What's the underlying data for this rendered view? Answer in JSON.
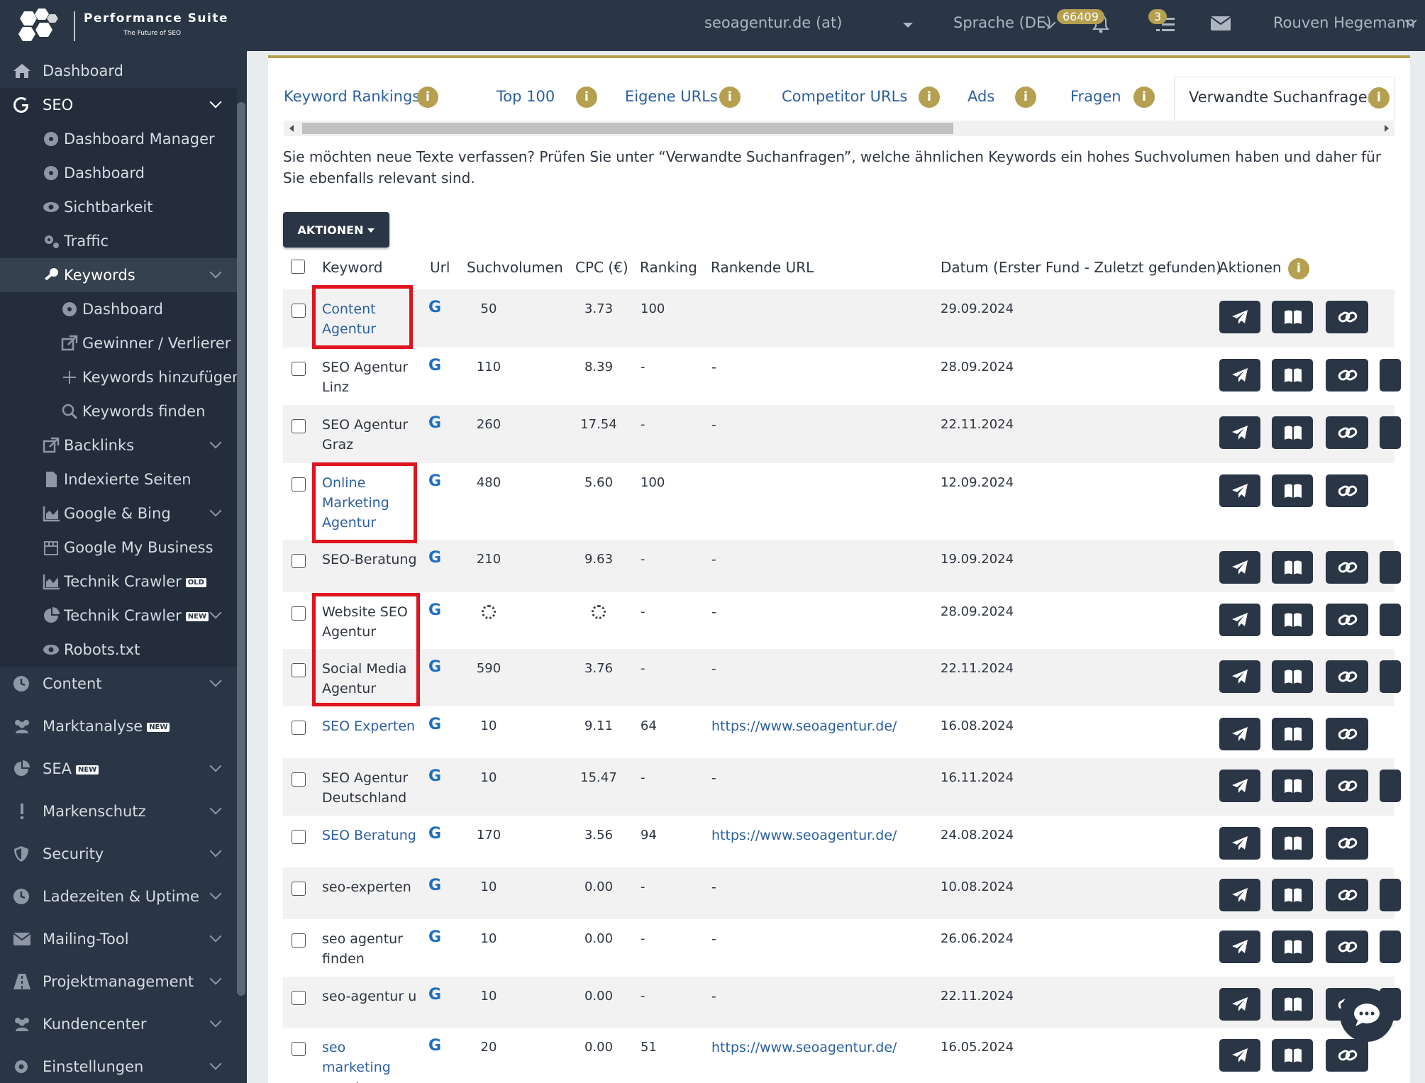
{
  "app": {
    "title": "Performance Suite",
    "subtitle": "The Future of SEO"
  },
  "topbar": {
    "project": "seoagentur.de (at)",
    "language": "Sprache (DE)",
    "notification_count": "66409",
    "task_count": "3",
    "user": "Rouven Hegemann"
  },
  "sidebar": {
    "items": [
      {
        "label": "Dashboard",
        "icon": "home-icon"
      },
      {
        "label": "SEO",
        "icon": "google-g-icon"
      },
      {
        "label": "Dashboard Manager",
        "icon": "dashboard-gauge-icon"
      },
      {
        "label": "Dashboard",
        "icon": "dashboard-gauge-icon"
      },
      {
        "label": "Sichtbarkeit",
        "icon": "eye-icon"
      },
      {
        "label": "Traffic",
        "icon": "cogs-icon"
      },
      {
        "label": "Keywords",
        "icon": "key-icon"
      },
      {
        "label": "Dashboard",
        "icon": "dashboard-gauge-icon"
      },
      {
        "label": "Gewinner / Verlierer",
        "icon": "external-link-icon"
      },
      {
        "label": "Keywords hinzufügen",
        "icon": "plus-icon"
      },
      {
        "label": "Keywords finden",
        "icon": "search-icon"
      },
      {
        "label": "Backlinks",
        "icon": "external-link-icon"
      },
      {
        "label": "Indexierte Seiten",
        "icon": "file-icon"
      },
      {
        "label": "Google & Bing",
        "icon": "area-chart-icon"
      },
      {
        "label": "Google My Business",
        "icon": "store-icon"
      },
      {
        "label": "Technik Crawler",
        "icon": "area-chart-icon",
        "tag": "OLD"
      },
      {
        "label": "Technik Crawler",
        "icon": "pie-chart-icon",
        "tag": "NEW"
      },
      {
        "label": "Robots.txt",
        "icon": "eye-icon"
      },
      {
        "label": "Content",
        "icon": "clock-icon"
      },
      {
        "label": "Marktanalyse",
        "icon": "users-icon",
        "tag": "NEW"
      },
      {
        "label": "SEA",
        "icon": "pie-chart-icon",
        "tag": "NEW"
      },
      {
        "label": "Markenschutz",
        "icon": "exclamation-icon"
      },
      {
        "label": "Security",
        "icon": "shield-icon"
      },
      {
        "label": "Ladezeiten & Uptime",
        "icon": "clock-icon"
      },
      {
        "label": "Mailing-Tool",
        "icon": "envelope-icon"
      },
      {
        "label": "Projektmanagement",
        "icon": "road-icon"
      },
      {
        "label": "Kundencenter",
        "icon": "users-icon"
      },
      {
        "label": "Einstellungen",
        "icon": "gear-icon"
      }
    ]
  },
  "tabs": [
    {
      "label": "Keyword Rankings"
    },
    {
      "label": "Top 100"
    },
    {
      "label": "Eigene URLs"
    },
    {
      "label": "Competitor URLs"
    },
    {
      "label": "Ads"
    },
    {
      "label": "Fragen"
    },
    {
      "label": "Verwandte Suchanfragen",
      "active": true
    }
  ],
  "intro": "Sie möchten neue Texte verfassen? Prüfen Sie unter “Verwandte Suchanfragen”, welche ähnlichen Keywords ein hohes Suchvolumen haben und daher für Sie ebenfalls relevant sind.",
  "actions_button": "AKTIONEN",
  "table": {
    "headers": {
      "keyword": "Keyword",
      "url": "Url",
      "volume": "Suchvolumen",
      "cpc": "CPC (€)",
      "ranking": "Ranking",
      "ranking_url": "Rankende URL",
      "date": "Datum (Erster Fund - Zuletzt gefunden)",
      "actions": "Aktionen"
    },
    "rows": [
      {
        "keyword": "Content Agentur",
        "linked": true,
        "g": "G",
        "volume": "50",
        "cpc": "3.73",
        "ranking": "100",
        "url": "",
        "date": "29.09.2024"
      },
      {
        "keyword": "SEO Agentur Linz",
        "linked": false,
        "g": "G",
        "volume": "110",
        "cpc": "8.39",
        "ranking": "-",
        "url": "-",
        "date": "28.09.2024"
      },
      {
        "keyword": "SEO Agentur Graz",
        "linked": false,
        "g": "G",
        "volume": "260",
        "cpc": "17.54",
        "ranking": "-",
        "url": "-",
        "date": "22.11.2024"
      },
      {
        "keyword": "Online Marketing Agentur",
        "linked": true,
        "g": "G",
        "volume": "480",
        "cpc": "5.60",
        "ranking": "100",
        "url": "",
        "date": "12.09.2024"
      },
      {
        "keyword": "SEO-Beratung",
        "linked": false,
        "g": "G",
        "volume": "210",
        "cpc": "9.63",
        "ranking": "-",
        "url": "-",
        "date": "19.09.2024"
      },
      {
        "keyword": "Website SEO Agentur",
        "linked": false,
        "g": "G",
        "volume": "",
        "cpc": "",
        "ranking": "-",
        "url": "-",
        "date": "28.09.2024",
        "loading": true
      },
      {
        "keyword": "Social Media Agentur",
        "linked": false,
        "g": "G",
        "volume": "590",
        "cpc": "3.76",
        "ranking": "-",
        "url": "-",
        "date": "22.11.2024"
      },
      {
        "keyword": "SEO Experten",
        "linked": true,
        "g": "G",
        "volume": "10",
        "cpc": "9.11",
        "ranking": "64",
        "url": "https://www.seoagentur.de/",
        "date": "16.08.2024"
      },
      {
        "keyword": "SEO Agentur Deutschland",
        "linked": false,
        "g": "G",
        "volume": "10",
        "cpc": "15.47",
        "ranking": "-",
        "url": "-",
        "date": "16.11.2024"
      },
      {
        "keyword": "SEO Beratung",
        "linked": true,
        "g": "G",
        "volume": "170",
        "cpc": "3.56",
        "ranking": "94",
        "url": "https://www.seoagentur.de/",
        "date": "24.08.2024"
      },
      {
        "keyword": "seo-experten",
        "linked": false,
        "g": "G",
        "volume": "10",
        "cpc": "0.00",
        "ranking": "-",
        "url": "-",
        "date": "10.08.2024"
      },
      {
        "keyword": "seo agentur finden",
        "linked": false,
        "g": "G",
        "volume": "10",
        "cpc": "0.00",
        "ranking": "-",
        "url": "-",
        "date": "26.06.2024"
      },
      {
        "keyword": "seo-agentur u",
        "linked": false,
        "g": "G",
        "volume": "10",
        "cpc": "0.00",
        "ranking": "-",
        "url": "-",
        "date": "22.11.2024"
      },
      {
        "keyword": "seo marketing agentur",
        "linked": true,
        "g": "G",
        "volume": "20",
        "cpc": "0.00",
        "ranking": "51",
        "url": "https://www.seoagentur.de/",
        "date": "16.05.2024"
      }
    ]
  },
  "colors": {
    "sidebar_bg": "#2a3545",
    "accent_gold": "#b5a050",
    "link_blue": "#2a5fa0",
    "highlight_red": "#e0141e"
  }
}
